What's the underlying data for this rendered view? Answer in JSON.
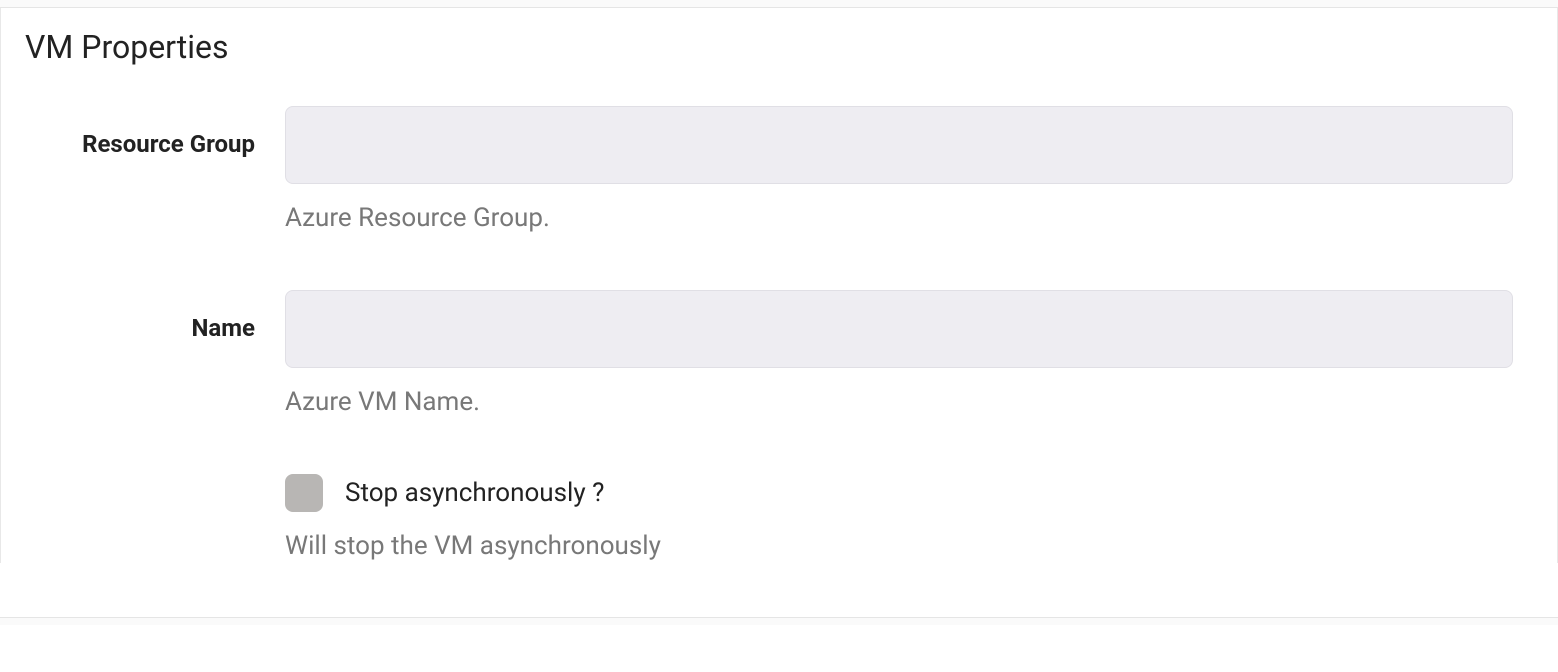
{
  "section": {
    "title": "VM Properties"
  },
  "fields": {
    "resource_group": {
      "label": "Resource Group",
      "value": "",
      "help": "Azure Resource Group."
    },
    "name": {
      "label": "Name",
      "value": "",
      "help": "Azure VM Name."
    },
    "stop_async": {
      "label": "Stop asynchronously ?",
      "checked": false,
      "help": "Will stop the VM asynchronously"
    }
  }
}
